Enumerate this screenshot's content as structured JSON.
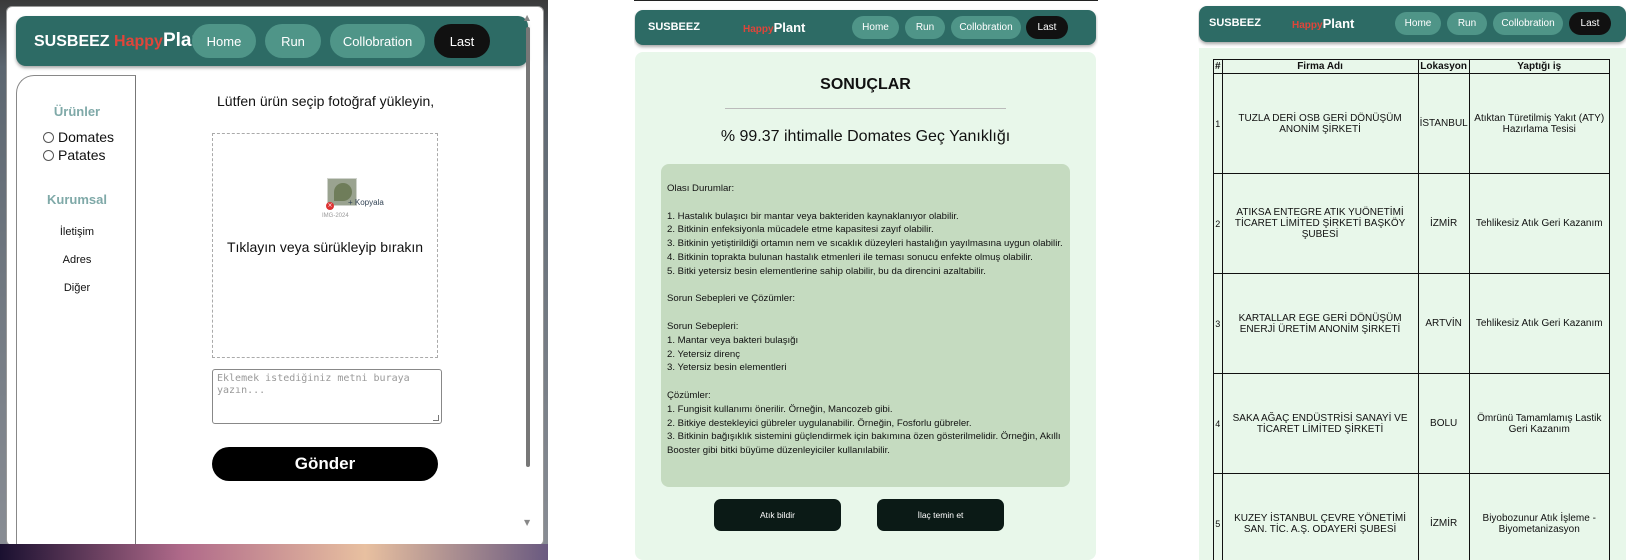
{
  "nav": {
    "brand_prefix": "SUSBEEZ",
    "brand_happy": "Happy",
    "brand_plant": "Plant",
    "items": [
      "Home",
      "Run",
      "Collobration",
      "Last"
    ]
  },
  "upload_page": {
    "sidebar": {
      "products_heading": "Ürünler",
      "products": [
        "Domates",
        "Patates"
      ],
      "corporate_heading": "Kurumsal",
      "links": [
        "İletişim",
        "Adres",
        "Diğer"
      ]
    },
    "instruction": "Lütfen ürün seçip fotoğraf yükleyin,",
    "dropzone": {
      "copy_label": "+ Kopyala",
      "file_label": "IMG-2024",
      "text": "Tıklayın veya sürükleyip bırakın"
    },
    "textarea_placeholder": "Eklemek istediğiniz metni buraya yazın...",
    "submit_label": "Gönder"
  },
  "results_page": {
    "title": "SONUÇLAR",
    "prediction": "% 99.37 ihtimalle Domates Geç Yanıklığı",
    "body": {
      "s1_title": "Olası Durumlar:",
      "s1_items": [
        "1. Hastalık bulaşıcı bir mantar veya bakteriden kaynaklanıyor olabilir.",
        "2. Bitkinin enfeksiyonla mücadele etme kapasitesi zayıf olabilir.",
        "3. Bitkinin yetiştirildiği ortamın nem ve sıcaklık düzeyleri hastalığın yayılmasına uygun olabilir.",
        "4. Bitkinin toprakta bulunan hastalık etmenleri ile teması sonucu enfekte olmuş olabilir.",
        "5. Bitki yetersiz besin elementlerine sahip olabilir, bu da direncini azaltabilir."
      ],
      "s2_title": "Sorun Sebepleri ve Çözümler:",
      "s3_title": "Sorun Sebepleri:",
      "s3_items": [
        "1. Mantar veya bakteri bulaşığı",
        "2. Yetersiz direnç",
        "3. Yetersiz besin elementleri"
      ],
      "s4_title": "Çözümler:",
      "s4_items": [
        "1. Fungisit kullanımı önerilir. Örneğin, Mancozeb gibi.",
        "2. Bitkiye destekleyici gübreler uygulanabilir. Örneğin, Fosforlu gübreler.",
        "3. Bitkinin bağışıklık sistemini güçlendirmek için bakımına özen gösterilmelidir. Örneğin, Akıllı Booster gibi bitki büyüme düzenleyiciler kullanılabilir."
      ]
    },
    "buttons": [
      "Atık bildir",
      "İlaç temin et"
    ]
  },
  "firms_page": {
    "columns": [
      "#",
      "Firma Adı",
      "Lokasyon",
      "Yaptığı iş"
    ],
    "rows": [
      [
        "1",
        "TUZLA DERİ OSB GERİ DÖNÜŞÜM ANONİM ŞİRKETİ",
        "İSTANBUL",
        "Atıktan Türetilmiş Yakıt (ATY) Hazırlama Tesisi"
      ],
      [
        "2",
        "ATIKSA ENTEGRE ATIK YUÖNETİMİ TİCARET LİMİTED ŞİRKETİ BAŞKÖY ŞUBESİ",
        "İZMİR",
        "Tehlikesiz Atık Geri Kazanım"
      ],
      [
        "3",
        "KARTALLAR EGE GERİ DÖNÜŞÜM ENERJİ ÜRETİM ANONİM ŞİRKETİ",
        "ARTVİN",
        "Tehlikesiz Atık Geri Kazanım"
      ],
      [
        "4",
        "SAKA AĞAÇ ENDÜSTRİSİ SANAYİ VE TİCARET LİMİTED ŞİRKETİ",
        "BOLU",
        "Ömrünü Tamamlamış Lastik Geri Kazanım"
      ],
      [
        "5",
        "KUZEY İSTANBUL ÇEVRE YÖNETİMİ SAN. TİC. A.Ş. ODAYERİ ŞUBESİ",
        "İZMİR",
        "Biyobozunur Atık İşleme - Biyometanizasyon"
      ]
    ]
  },
  "colors": {
    "nav_bg": "#2d6b65",
    "nav_button": "#4f9588",
    "brand_accent": "#e0453a",
    "content_bg": "#e8f7ea",
    "results_box": "#c5dbc0"
  }
}
